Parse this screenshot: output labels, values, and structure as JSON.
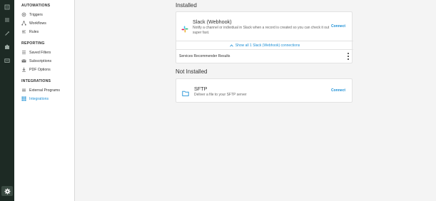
{
  "rail": {
    "icons": [
      "list-icon",
      "table-icon",
      "wand-icon",
      "bank-icon",
      "id-card-icon",
      "gear-icon"
    ]
  },
  "sidebar": {
    "sections": [
      {
        "title": "AUTOMATIONS",
        "items": [
          {
            "label": "Triggers",
            "icon": "trigger-icon"
          },
          {
            "label": "Workflows",
            "icon": "workflow-icon"
          },
          {
            "label": "Rules",
            "icon": "rules-icon"
          }
        ]
      },
      {
        "title": "REPORTING",
        "items": [
          {
            "label": "Saved Filters",
            "icon": "filter-list-icon"
          },
          {
            "label": "Subscriptions",
            "icon": "mail-icon"
          },
          {
            "label": "PDF Options",
            "icon": "download-icon"
          }
        ]
      },
      {
        "title": "INTEGRATIONS",
        "items": [
          {
            "label": "External Programs",
            "icon": "list-icon"
          },
          {
            "label": "Integrations",
            "icon": "grid-icon"
          }
        ]
      }
    ],
    "active": "Integrations"
  },
  "main": {
    "installed_title": "Installed",
    "slack": {
      "title": "Slack (Webhook)",
      "description": "Notify a channel or individual in Slack when a record is created so you can check it out super fast.",
      "connect": "Connect",
      "show_all": "Show all 1 Slack (Webhook) connections",
      "result": "Services Recommender Results"
    },
    "not_installed_title": "Not Installed",
    "sftp": {
      "title": "SFTP",
      "description": "Deliver a file to your SFTP server",
      "connect": "Connect"
    }
  },
  "colors": {
    "accent": "#1e90d6",
    "rail": "#1d2a24",
    "slack_green": "#2eb67d",
    "slack_blue": "#36c5f0",
    "slack_red": "#e01e5a",
    "slack_yellow": "#ecb22e"
  }
}
